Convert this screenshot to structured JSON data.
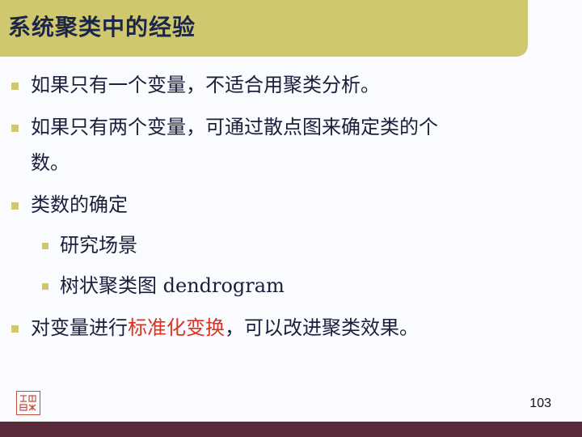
{
  "slide": {
    "title": "系统聚类中的经验",
    "bullets": [
      "如果只有一个变量，不适合用聚类分析。",
      "如果只有两个变量，可通过散点图来确定类的个",
      "数。",
      "类数的确定",
      "研究场景",
      "树状聚类图 dendrogram",
      "对变量进行",
      "标准化变换",
      "，可以改进聚类效果。"
    ],
    "page_number": "103"
  },
  "colors": {
    "title_bar": "#cfc86e",
    "title_text": "#1c2648",
    "body_text": "#1a1f3a",
    "highlight": "#e0301e",
    "footer": "#5a2a3a"
  }
}
